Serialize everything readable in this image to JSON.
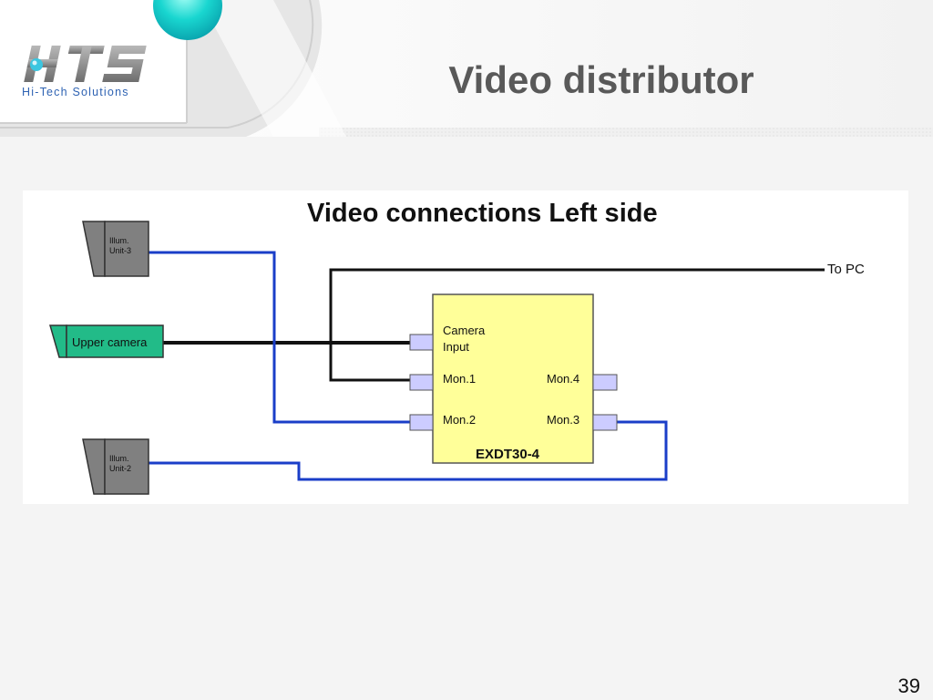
{
  "slide": {
    "title": "Video distributor",
    "page_number": "39"
  },
  "logo": {
    "name": "HTS",
    "subtitle": "Hi-Tech Solutions"
  },
  "diagram": {
    "title": "Video connections Left side",
    "to_pc_label": "To PC",
    "device_label": "EXDT30-4",
    "ports": {
      "camera_input_line1": "Camera",
      "camera_input_line2": "Input",
      "mon1": "Mon.1",
      "mon2": "Mon.2",
      "mon3": "Mon.3",
      "mon4": "Mon.4"
    },
    "illum_unit_3": {
      "line1": "Illum.",
      "line2": "Unit-3"
    },
    "illum_unit_2": {
      "line1": "Illum.",
      "line2": "Unit-2"
    },
    "upper_camera": "Upper camera",
    "colors": {
      "blue_cable": "#1a3ec8",
      "black_cable": "#111111",
      "device_fill": "#ffff99",
      "port_fill": "#ccccff",
      "camera_fill": "#22bb88",
      "illum_fill": "#808080"
    }
  }
}
